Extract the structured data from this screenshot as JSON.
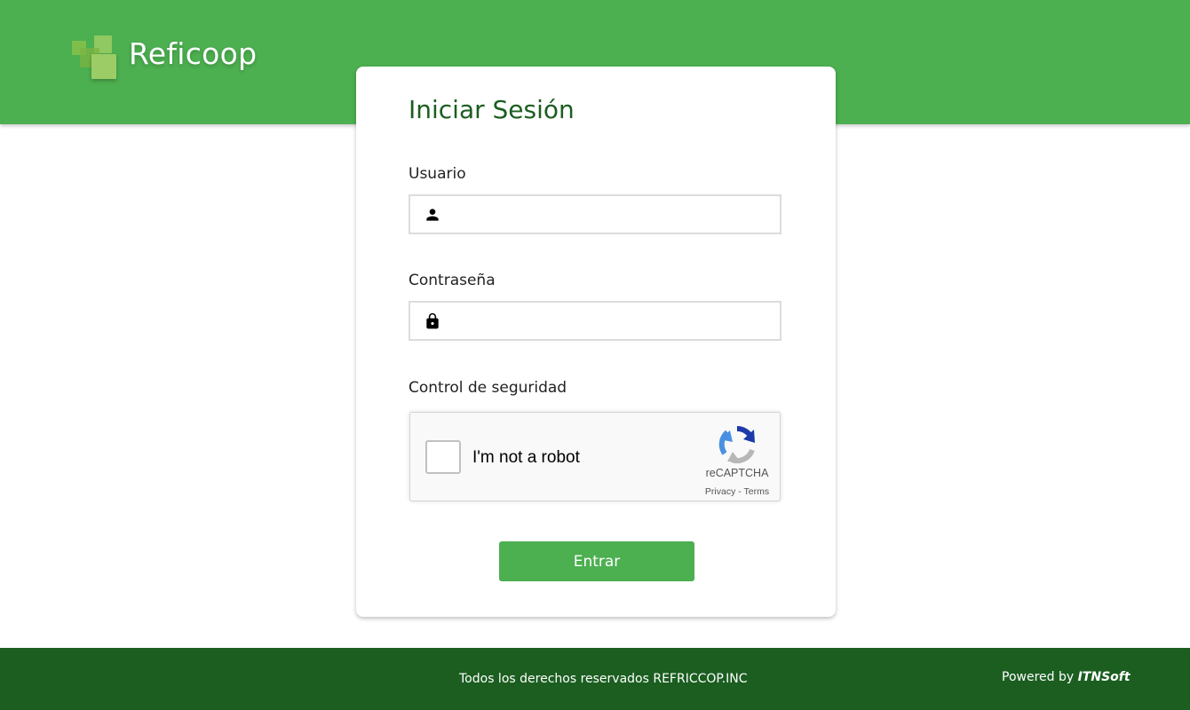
{
  "header": {
    "brand": "Reficoop"
  },
  "login": {
    "title": "Iniciar Sesión",
    "username_label": "Usuario",
    "username_value": "",
    "password_label": "Contraseña",
    "password_value": "",
    "security_label": "Control de seguridad",
    "submit_label": "Entrar"
  },
  "captcha": {
    "checkbox_label": "I'm not a robot",
    "brand": "reCAPTCHA",
    "privacy": "Privacy",
    "separator": " - ",
    "terms": "Terms",
    "checked": false
  },
  "footer": {
    "rights": "Todos los derechos reservados REFRICCOP.INC",
    "powered_prefix": "Powered by ",
    "powered_brand": "ITNSoft"
  },
  "icons": {
    "user": "person-icon",
    "password": "lock-icon",
    "captcha": "recaptcha-logo-icon"
  },
  "colors": {
    "header_green": "#4caf50",
    "footer_green": "#1b5e20",
    "title_green": "#1b5e20",
    "button_green": "#4caf50"
  }
}
